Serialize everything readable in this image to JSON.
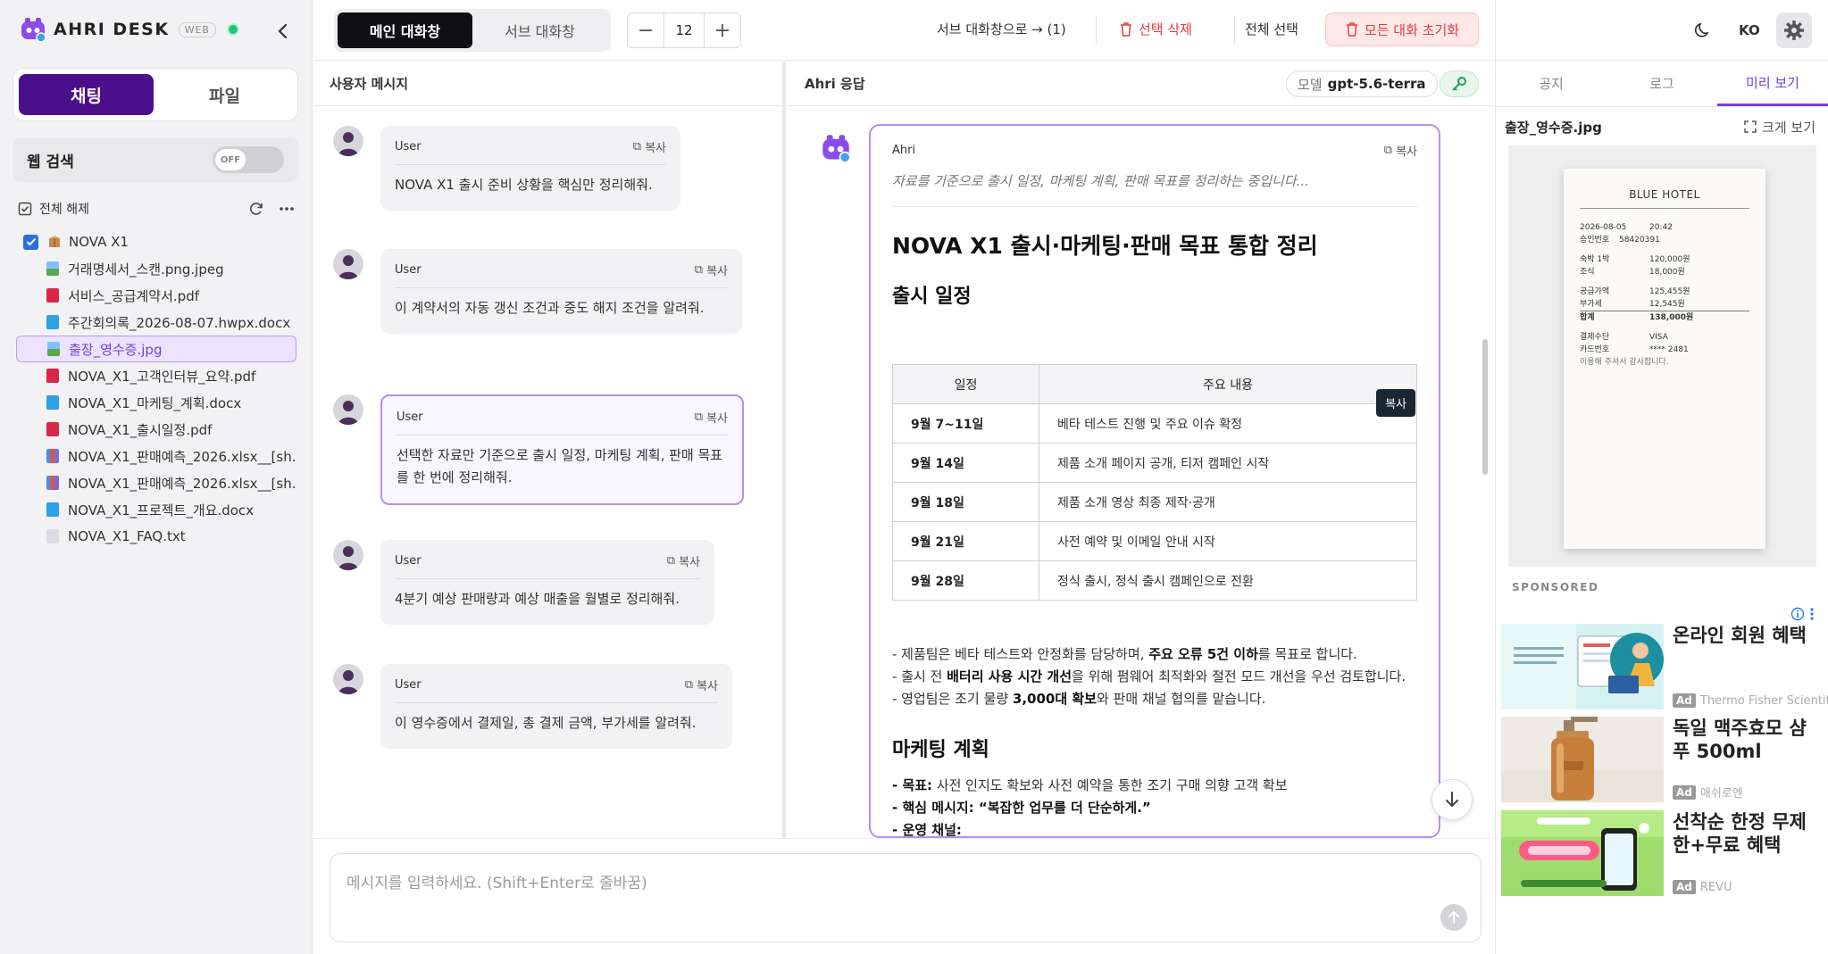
{
  "app": {
    "name": "AHRI DESK",
    "badge": "WEB"
  },
  "sidebar": {
    "modes": [
      "채팅",
      "파일"
    ],
    "web_search_label": "웹 검색",
    "web_search_state": "OFF",
    "deselect_all": "전체 해제",
    "tree": {
      "root": "NOVA X1",
      "items": [
        {
          "name": "거래명세서_스캔.png.jpeg",
          "type": "image"
        },
        {
          "name": "서비스_공급계약서.pdf",
          "type": "pdf"
        },
        {
          "name": "주간회의록_2026-08-07.hwpx.docx",
          "type": "doc"
        },
        {
          "name": "출장_영수증.jpg",
          "type": "image"
        },
        {
          "name": "NOVA_X1_고객인터뷰_요약.pdf",
          "type": "pdf"
        },
        {
          "name": "NOVA_X1_마케팅_계획.docx",
          "type": "doc"
        },
        {
          "name": "NOVA_X1_출시일정.pdf",
          "type": "pdf"
        },
        {
          "name": "NOVA_X1_판매예측_2026.xlsx__[sh...",
          "type": "sheet"
        },
        {
          "name": "NOVA_X1_판매예측_2026.xlsx__[sh...",
          "type": "sheet"
        },
        {
          "name": "NOVA_X1_프로젝트_개요.docx",
          "type": "doc"
        },
        {
          "name": "NOVA_X1_FAQ.txt",
          "type": "txt"
        }
      ]
    }
  },
  "topbar": {
    "tabs": [
      "메인 대화창",
      "서브 대화창"
    ],
    "stepper_value": "12",
    "send_to_sub": "서브 대화창으로 → (1)",
    "delete_selected": "선택 삭제",
    "select_all": "전체 선택",
    "reset_all": "모든 대화 초기화"
  },
  "user_pane": {
    "title": "사용자 메시지",
    "messages": [
      {
        "author": "User",
        "copy": "복사",
        "text": "NOVA X1 출시 준비 상황을 핵심만 정리해줘."
      },
      {
        "author": "User",
        "copy": "복사",
        "text": "이 계약서의 자동 갱신 조건과 중도 해지 조건을 알려줘."
      },
      {
        "author": "User",
        "copy": "복사",
        "text": "선택한 자료만 기준으로 출시 일정, 마케팅 계획, 판매 목표를 한 번에 정리해줘."
      },
      {
        "author": "User",
        "copy": "복사",
        "text": "4분기 예상 판매량과 예상 매출을 월별로 정리해줘."
      },
      {
        "author": "User",
        "copy": "복사",
        "text": "이 영수증에서 결제일, 총 결제 금액, 부가세를 알려줘."
      }
    ]
  },
  "ai_pane": {
    "title": "Ahri 응답",
    "model_label": "모델",
    "model_name": "gpt-5.6-terra",
    "author": "Ahri",
    "copy": "복사",
    "thinking": "자료를 기준으로 출시 일정, 마케팅 계획, 판매 목표를 정리하는 중입니다...",
    "h1": "NOVA X1 출시·마케팅·판매 목표 통합 정리",
    "h2_schedule": "출시 일정",
    "table_copy": "복사",
    "table_headers": [
      "일정",
      "주요 내용"
    ],
    "table_rows": [
      [
        "9월 7~11일",
        "베타 테스트 진행 및 주요 이슈 확정"
      ],
      [
        "9월 14일",
        "제품 소개 페이지 공개, 티저 캠페인 시작"
      ],
      [
        "9월 18일",
        "제품 소개 영상 최종 제작·공개"
      ],
      [
        "9월 21일",
        "사전 예약 및 이메일 안내 시작"
      ],
      [
        "9월 28일",
        "정식 출시, 정식 출시 캠페인으로 전환"
      ]
    ],
    "bullet1_pre": "- 제품팀은 베타 테스트와 안정화를 담당하며, ",
    "bullet1_bold": "주요 오류 5건 이하",
    "bullet1_post": "를 목표로 합니다.",
    "bullet2_pre": "- 출시 전 ",
    "bullet2_bold": "배터리 사용 시간 개선",
    "bullet2_post": "을 위해 펌웨어 최적화와 절전 모드 개선을 우선 검토합니다.",
    "bullet3_pre": "- 영업팀은 조기 물량 ",
    "bullet3_bold": "3,000대 확보",
    "bullet3_post": "와 판매 채널 협의를 맡습니다.",
    "h2_marketing": "마케팅 계획",
    "mk1_label": "- 목표:",
    "mk1_text": " 사전 인지도 확보와 사전 예약을 통한 조기 구매 의향 고객 확보",
    "mk2_label": "- 핵심 메시지:",
    "mk2_text": " “복잡한 업무를 더 단순하게.”",
    "mk3_label": "- 운영 채널:"
  },
  "input": {
    "placeholder": "메시지를 입력하세요. (Shift+Enter로 줄바꿈)"
  },
  "right_panel": {
    "lang": "KO",
    "tabs": [
      "공지",
      "로그",
      "미리 보기"
    ],
    "preview_name": "출장_영수증.jpg",
    "enlarge": "크게 보기",
    "receipt": {
      "title": "BLUE HOTEL",
      "lines": [
        [
          "2026-08-05",
          "20:42"
        ],
        [
          "승인번호",
          "58420391"
        ],
        [
          "숙박 1박",
          "120,000원"
        ],
        [
          "조식",
          "18,000원"
        ],
        [
          "공급가액",
          "125,455원"
        ],
        [
          "부가세",
          "12,545원"
        ],
        [
          "합계",
          "138,000원"
        ],
        [
          "결제수단",
          "VISA"
        ],
        [
          "카드번호",
          "**** 2481"
        ],
        [
          "이용해 주셔서 감사합니다.",
          ""
        ]
      ]
    },
    "sponsored": "SPONSORED",
    "ads": [
      {
        "title": "온라인 회원 혜택",
        "source": "Thermo Fisher Scientific",
        "badge": "Ad"
      },
      {
        "title": "독일 맥주효모 샴푸 500ml",
        "source": "애쉬로엔",
        "badge": "Ad"
      },
      {
        "title": "선착순 한정 무제한+무료 혜택",
        "source": "REVU",
        "badge": "Ad"
      }
    ]
  },
  "colors": {
    "accent": "#4c0f8c",
    "selection": "#b88ef0",
    "danger": "#e23b3b",
    "online": "#1fc47a"
  }
}
